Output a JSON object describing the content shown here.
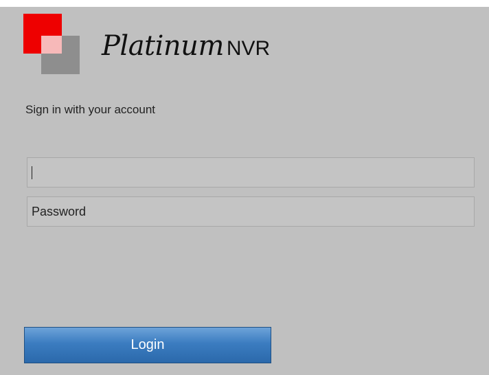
{
  "brand": {
    "script_name": "Platinum",
    "product_name": "NVR"
  },
  "signin": {
    "instruction": "Sign in with your account"
  },
  "form": {
    "username_value": "",
    "username_placeholder": "",
    "password_placeholder": "Password"
  },
  "login_button": {
    "label": "Login"
  },
  "colors": {
    "logo_red": "#ee0000",
    "logo_pink": "#f7b9b9",
    "logo_gray": "#8e8e8e",
    "panel_background": "#c0c0c0",
    "button_blue": "#3b7cc0"
  }
}
